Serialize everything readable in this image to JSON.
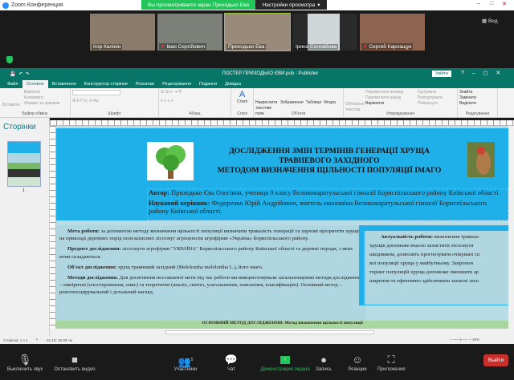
{
  "zoom": {
    "title": "Zoom Конференция",
    "banner": "Вы просматриваете экран Приходько Ева",
    "view_settings": "Настройки просмотра",
    "view": "Вид",
    "participants": [
      {
        "name": "Ігор Калінін",
        "muted": false
      },
      {
        "name": "Іван Сергійович",
        "muted": true
      },
      {
        "name": "Приходько Ева",
        "muted": false
      },
      {
        "name": "Ірина Соловйова",
        "muted": false
      },
      {
        "name": "Сергей Карлащук",
        "muted": true
      }
    ],
    "toolbar": {
      "mute": "Выключить звук",
      "video": "Остановить видео",
      "participants": "Участники",
      "participants_count": "5",
      "chat": "Чат",
      "share": "Демонстрация экрана",
      "record": "Запись",
      "reactions": "Реакции",
      "apps": "Приложения",
      "leave": "Выйти"
    }
  },
  "publisher": {
    "title": "ПОСТЕР ПРИХОДЬКО ЄВИ.pub  -  Publisher",
    "login": "Увійти",
    "tabs": [
      "Файл",
      "Основне",
      "Вставлення",
      "Конструктор сторінки",
      "Розсилки",
      "Рецензування",
      "Подання",
      "Довідка"
    ],
    "ribbon": {
      "paste": "Вставити",
      "cut": "Вирізати",
      "copy": "Копіювати",
      "format_painter": "Формат за зразком",
      "clipboard": "Буфер обміну",
      "font": "Шрифт",
      "paragraph": "Абзац",
      "styles": "Стилі",
      "draw_textbox": "Накреслити текстове поле",
      "pictures": "Зображення",
      "table": "Таблиця",
      "shapes": "Фігури",
      "objects": "Об'єкти",
      "wrap_text": "Обтікання текстом",
      "bring_forward": "Перемістити вперед",
      "send_backward": "Перемістити назад",
      "align": "Вирівняти",
      "group": "Групувати",
      "ungroup": "Розгрупувати",
      "rotate": "Повернути",
      "arrange": "Упорядкування",
      "find": "Знайти",
      "replace": "Замінити",
      "select": "Виділити",
      "editing": "Редагування"
    },
    "pages_pane": {
      "title": "Сторінки",
      "page_number": "1"
    },
    "status": {
      "page": "Сторінка: 1 з 1",
      "position": "61,16; 18,08 см",
      "zoom": "48%"
    }
  },
  "poster": {
    "title_lines": [
      "ДОСЛІДЖЕННЯ ЗМІН ТЕРМІНІВ  ГЕНЕРАЦІЇ ХРУЩА",
      "ТРАВНЕВОГО ЗАХІДНОГО",
      "МЕТОДОМ ВИЗНАЧЕННЯ ЩІЛЬНОСТІ ПОПУЛЯЦІЇ ІМАГО"
    ],
    "author_label": "Автор:",
    "author": " Приходько Єва Олегівна, учениця 9 класу Великокаратульської гімназії Бориспільського району Київської області.",
    "supervisor_label": "Науковий керівник:",
    "supervisor": " Федоренко Юрій Андрійович, вчитель економіки Великокаратульської гімназії Бориспільського району Київської області.",
    "goal_label": "Мета роботи:",
    "goal": " за допомогою методу визначення щільності популяції визначити тривалість генерації  та харчові пріоритети хрущів на прикладі деревних порід полезахисних лісосмуг агроценозів агрофірми «Україна» Бориспільського району.",
    "subject_label": "Предмет дослідження:",
    "subject": " лісосмуги агрофірми \"УКРАЇНА\" Бориспільського району Київської  області та деревні породи, з яких вони складаються.",
    "object_label": "Об'єкт дослідження:",
    "object": " хрущ травневий західний (Melolontha melolontha L.), його імаго.",
    "methods_label": "Методи дослідження.",
    "methods": " Для досягнення поставленої мети під час роботи ми використовували загальнонаукові методи дослідження – емпіричні (спостереження, опис) та теоретичні (аналіз, синтез, узагальнення, пояснення, класифікацію). Основний метод – рекогносцирувальний і детальний нагляд.",
    "relevance_label": "Актуальність роботи:",
    "relevance_lines": [
      "  визначення тривало",
      "хрущів допоможе вчасно захистити лісосмуги",
      "шкідником, дозволить прогнозувати очікувані сп",
      "вої популяції  хруща  у майбутньому. Запропон",
      "торинг популяцій хруща допоможе зменшити ар",
      "ширення та ефективно здійснювати захисні захо"
    ],
    "main_method": "ОСНОВНИЙ МЕТОД ДОСЛІДЖЕННЯ: Метод визначення щільності популяції"
  },
  "colors": {
    "zoom_green": "#23c45a",
    "publisher_teal": "#077568",
    "poster_blue": "#1fb0ea",
    "box_blue": "#b0d6e2",
    "leave_red": "#c9302c"
  }
}
